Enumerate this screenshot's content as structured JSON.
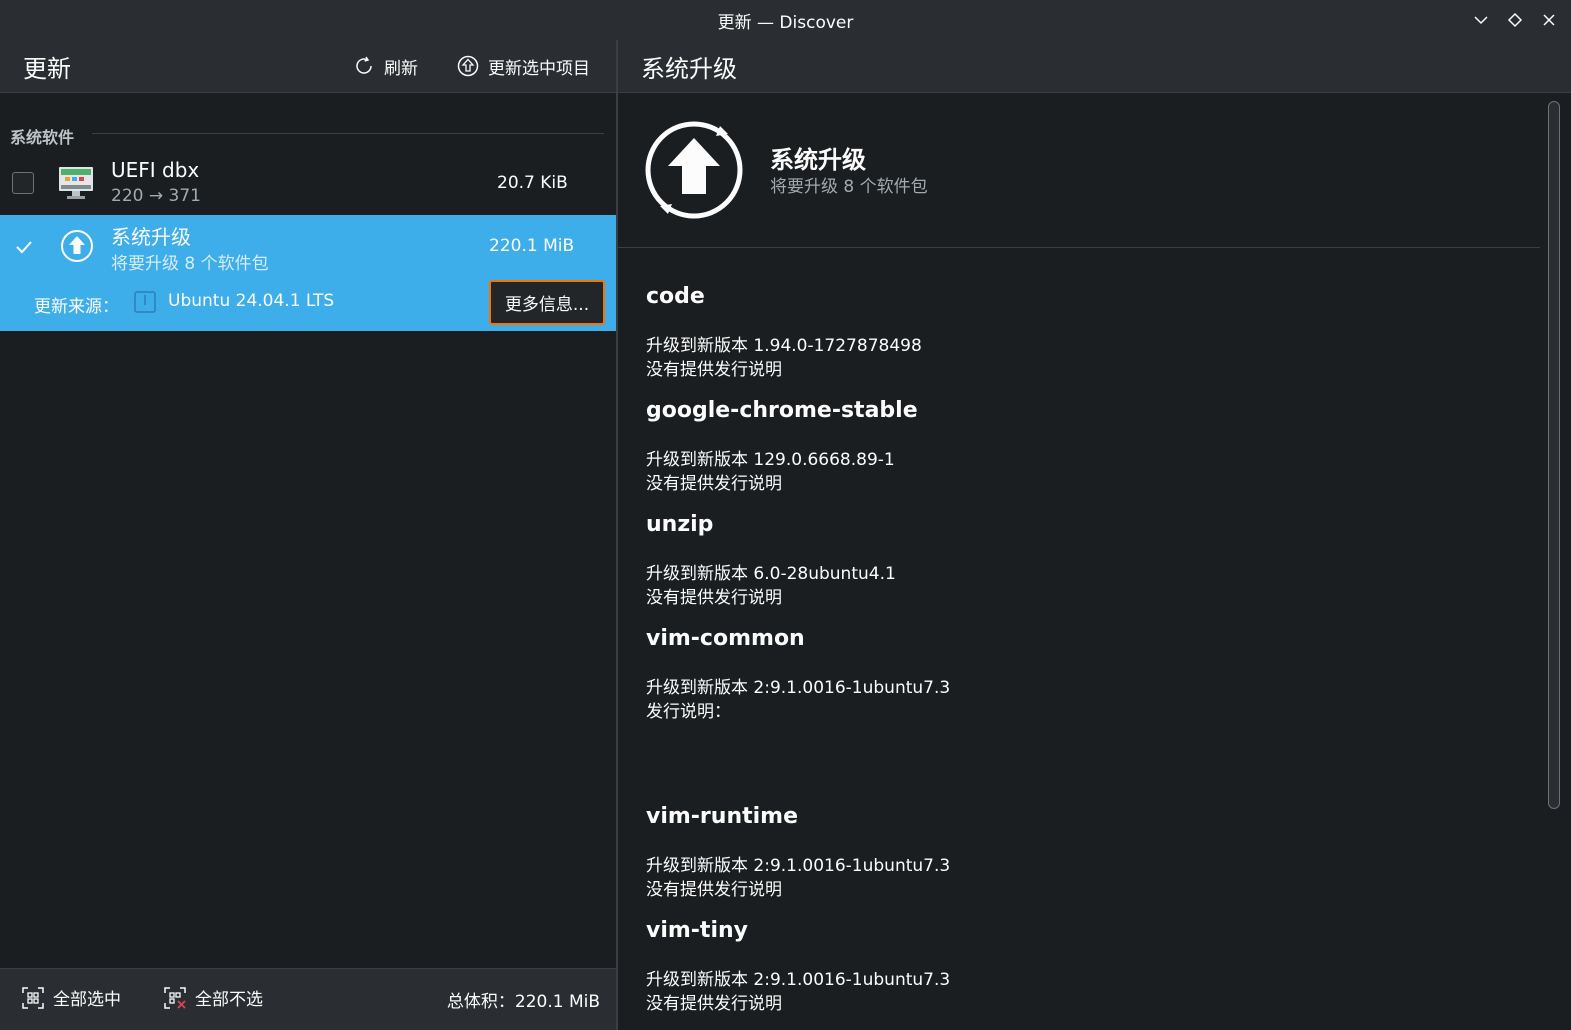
{
  "window": {
    "title": "更新 — Discover"
  },
  "left_header": {
    "title": "更新",
    "refresh_label": "刷新",
    "update_selected_label": "更新选中项目"
  },
  "right_header": {
    "title": "系统升级"
  },
  "list": {
    "section": "系统软件",
    "items": [
      {
        "name": "UEFI dbx",
        "version": "220 → 371",
        "size": "20.7 KiB",
        "checked": false
      },
      {
        "name": "系统升级",
        "version": "将要升级 8 个软件包",
        "size": "220.1 MiB",
        "checked": true
      }
    ],
    "source_label": "更新来源：",
    "source_value": "Ubuntu 24.04.1 LTS",
    "more_info": "更多信息..."
  },
  "footer": {
    "select_all": "全部选中",
    "select_none": "全部不选",
    "total": "总体积：220.1 MiB"
  },
  "detail": {
    "title": "系统升级",
    "subtitle": "将要升级 8 个软件包",
    "packages": [
      {
        "name": "code",
        "line1": "升级到新版本 1.94.0-1727878498",
        "line2": "没有提供发行说明"
      },
      {
        "name": "google-chrome-stable",
        "line1": "升级到新版本 129.0.6668.89-1",
        "line2": "没有提供发行说明"
      },
      {
        "name": "unzip",
        "line1": "升级到新版本 6.0-28ubuntu4.1",
        "line2": "没有提供发行说明"
      },
      {
        "name": "vim-common",
        "line1": "升级到新版本 2:9.1.0016-1ubuntu7.3",
        "line2": "发行说明："
      },
      {
        "name": "vim-runtime",
        "line1": "升级到新版本 2:9.1.0016-1ubuntu7.3",
        "line2": "没有提供发行说明"
      },
      {
        "name": "vim-tiny",
        "line1": "升级到新版本 2:9.1.0016-1ubuntu7.3",
        "line2": "没有提供发行说明"
      }
    ]
  },
  "colors": {
    "accent": "#3daee9",
    "focus": "#f67400",
    "background": "#1b1e20",
    "header": "#2a2e32"
  }
}
